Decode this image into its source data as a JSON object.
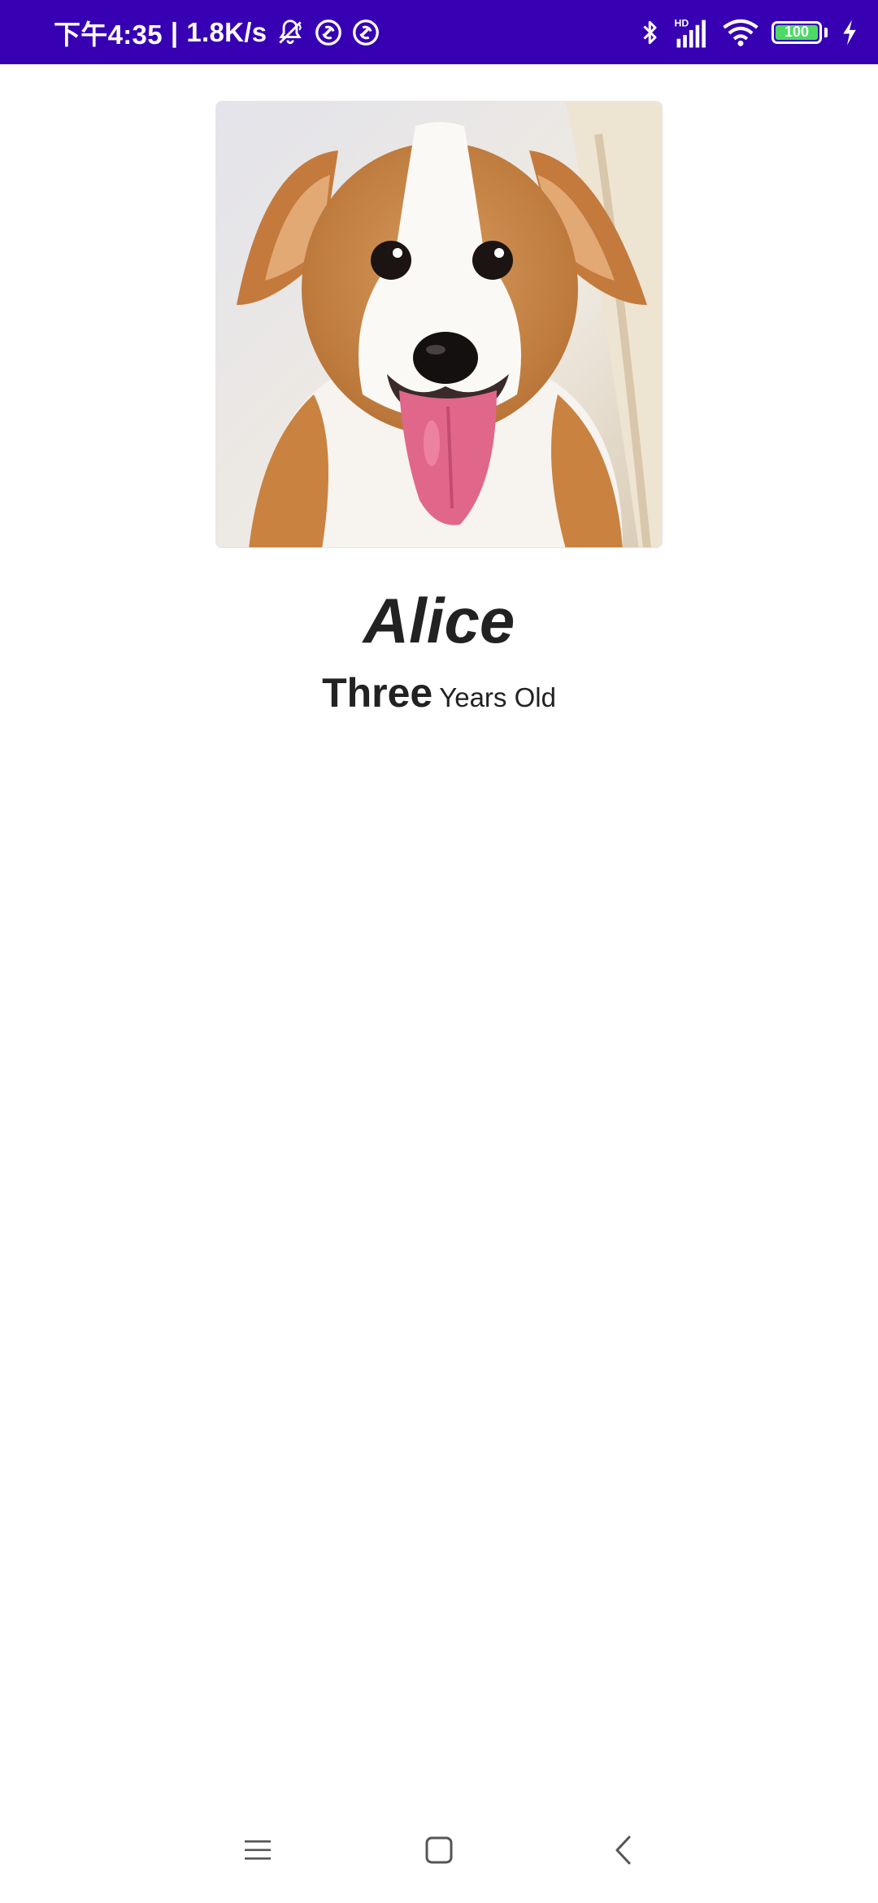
{
  "status_bar": {
    "time": "下午4:35",
    "separator": "|",
    "network_speed": "1.8K/s",
    "battery_level": "100",
    "background_color": "#3700b3",
    "icons": [
      "bell-muted-icon",
      "sync-icon",
      "sync-icon",
      "bluetooth-icon",
      "hd-signal-icon",
      "wifi-icon",
      "battery-icon",
      "charging-icon"
    ]
  },
  "pet": {
    "photo_icon": "dog-photo",
    "name": "Alice",
    "age_number": "Three",
    "age_unit": "Years Old"
  },
  "nav_bar": {
    "icons": [
      "menu-icon",
      "home-icon",
      "back-icon"
    ]
  }
}
